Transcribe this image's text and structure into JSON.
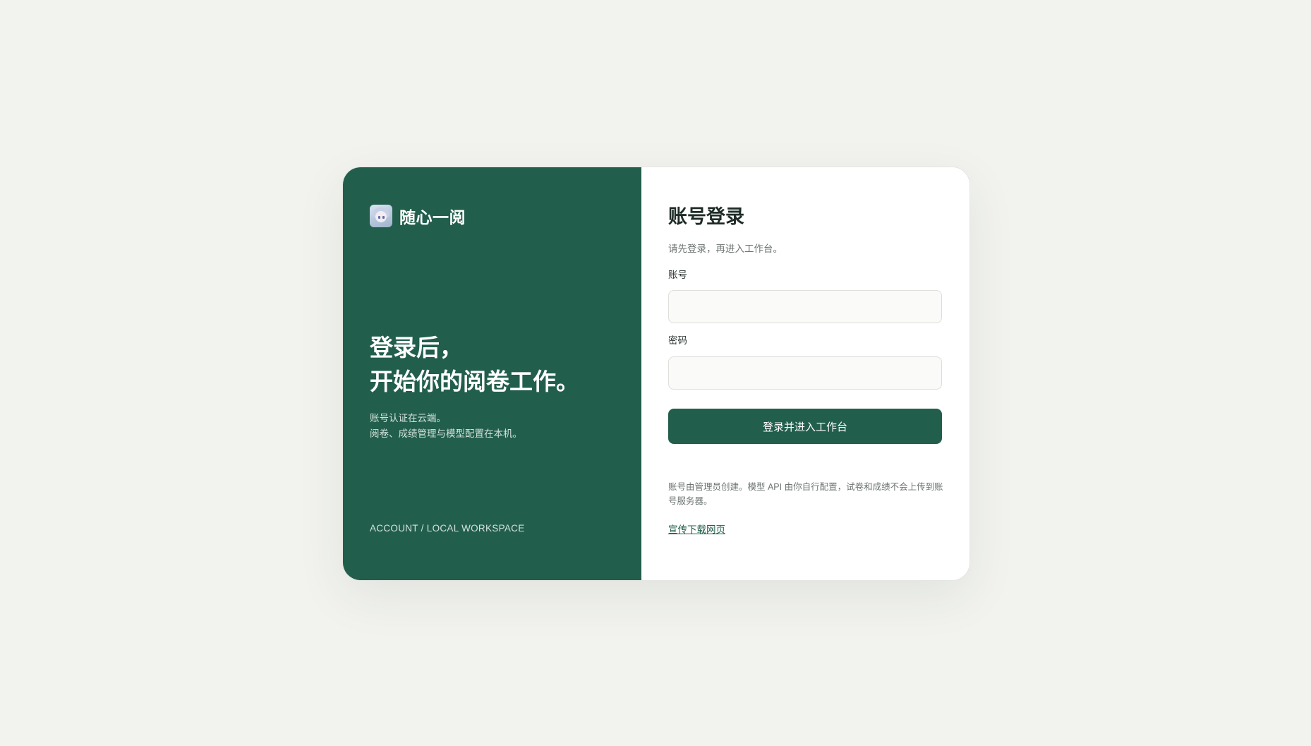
{
  "brand": {
    "name": "随心一阅",
    "logo_icon": "anime-avatar-logo"
  },
  "hero": {
    "headline_line1": "登录后，",
    "headline_line2": "开始你的阅卷工作。",
    "desc_line1": "账号认证在云端。",
    "desc_line2": "阅卷、成绩管理与模型配置在本机。",
    "footer_tag": "ACCOUNT / LOCAL WORKSPACE"
  },
  "login": {
    "title": "账号登录",
    "subtitle": "请先登录，再进入工作台。",
    "account_label": "账号",
    "account_value": "",
    "account_placeholder": "",
    "password_label": "密码",
    "password_value": "",
    "password_placeholder": "",
    "submit_label": "登录并进入工作台",
    "note": "账号由管理员创建。模型 API 由你自行配置，试卷和成绩不会上传到账号服务器。",
    "download_link": "宣传下载网页"
  },
  "colors": {
    "page_bg": "#f2f3ef",
    "brand_green": "#225e4c",
    "card_bg": "#ffffff"
  }
}
